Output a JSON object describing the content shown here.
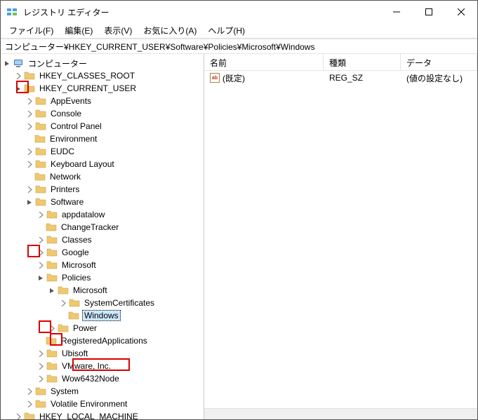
{
  "window": {
    "title": "レジストリ エディター"
  },
  "menu": {
    "file": "ファイル(F)",
    "edit": "編集(E)",
    "view": "表示(V)",
    "favorites": "お気に入り(A)",
    "help": "ヘルプ(H)"
  },
  "address": "コンピューター¥HKEY_CURRENT_USER¥Software¥Policies¥Microsoft¥Windows",
  "columns": {
    "name": "名前",
    "type": "種類",
    "data": "データ"
  },
  "values": [
    {
      "name": "(既定)",
      "type": "REG_SZ",
      "data": "(値の設定なし)"
    }
  ],
  "tree": {
    "root": "コンピューター",
    "hkcr": "HKEY_CLASSES_ROOT",
    "hkcu": "HKEY_CURRENT_USER",
    "hkcu_children": {
      "appevents": "AppEvents",
      "console": "Console",
      "controlpanel": "Control Panel",
      "environment": "Environment",
      "eudc": "EUDC",
      "keyboard": "Keyboard Layout",
      "network": "Network",
      "printers": "Printers",
      "software": "Software",
      "software_children": {
        "appdatalow": "appdatalow",
        "changetracker": "ChangeTracker",
        "classes": "Classes",
        "google": "Google",
        "microsoft": "Microsoft",
        "policies": "Policies",
        "policies_children": {
          "microsoft": "Microsoft",
          "ms_children": {
            "systemcertificates": "SystemCertificates",
            "windows": "Windows"
          },
          "power": "Power"
        },
        "registeredapps": "RegisteredApplications",
        "ubisoft": "Ubisoft",
        "vmware": "VMware, Inc.",
        "wow64": "Wow6432Node"
      },
      "system": "System",
      "volatile": "Volatile Environment"
    },
    "hklm": "HKEY_LOCAL_MACHINE"
  }
}
